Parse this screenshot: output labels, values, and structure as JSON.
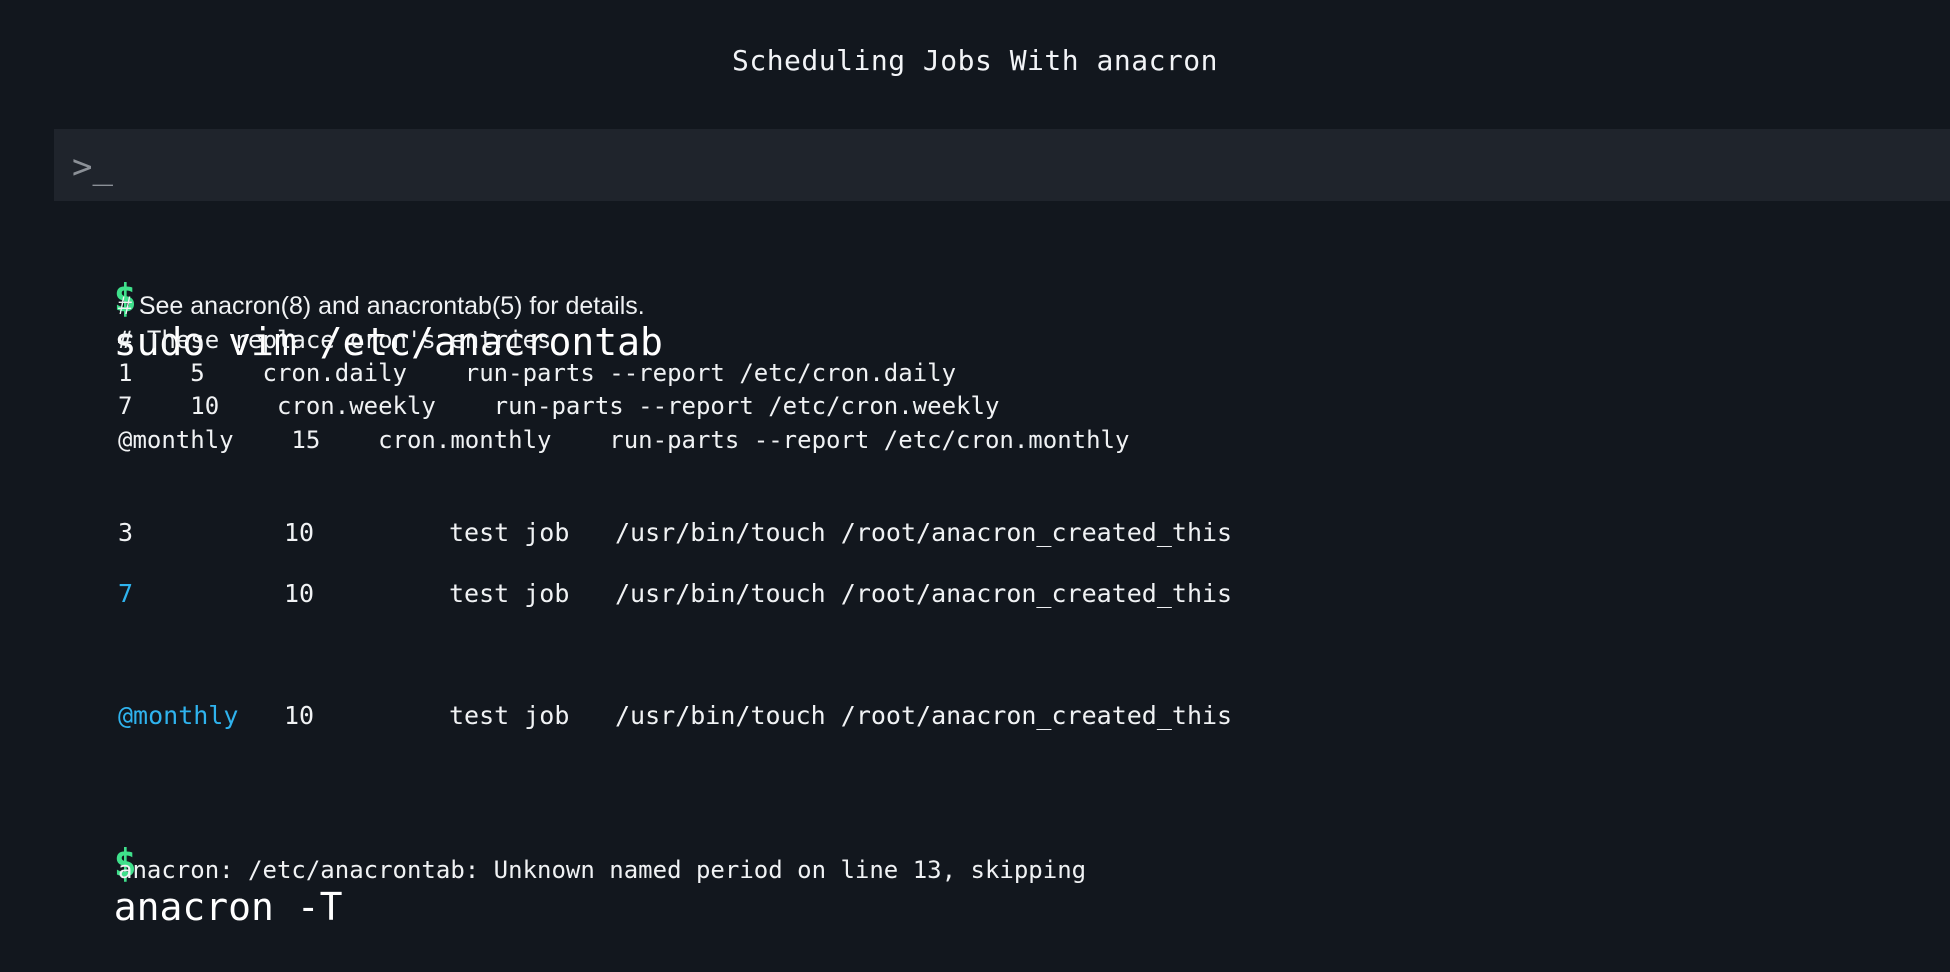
{
  "header": {
    "title": "Scheduling Jobs With anacron"
  },
  "terminal_bar": {
    "prompt_icon": ">_"
  },
  "session": {
    "prompt_symbol": "$",
    "command1": "sudo vim /etc/anacrontab",
    "file_lines": [
      "# See anacron(8) and anacrontab(5) for details.",
      "# These replace cron's entries",
      "1    5    cron.daily    run-parts --report /etc/cron.daily",
      "7    10    cron.weekly    run-parts --report /etc/cron.weekly",
      "@monthly    15    cron.monthly    run-parts --report /etc/cron.monthly"
    ],
    "jobs": [
      {
        "period": "3",
        "delay": "10",
        "id": "test job",
        "command": "/usr/bin/touch /root/anacron_created_this"
      },
      {
        "period": "7",
        "delay": "10",
        "id": "test job",
        "command": "/usr/bin/touch /root/anacron_created_this"
      },
      {
        "period": "@monthly",
        "delay": "10",
        "id": "test job",
        "command": "/usr/bin/touch /root/anacron_created_this"
      }
    ],
    "command2": "anacron -T",
    "output2": "anacron: /etc/anacrontab: Unknown named period on line 13, skipping"
  },
  "colors": {
    "background": "#12171e",
    "bar": "#1f242c",
    "prompt": "#3fe08b",
    "highlight": "#2fb3ee"
  }
}
